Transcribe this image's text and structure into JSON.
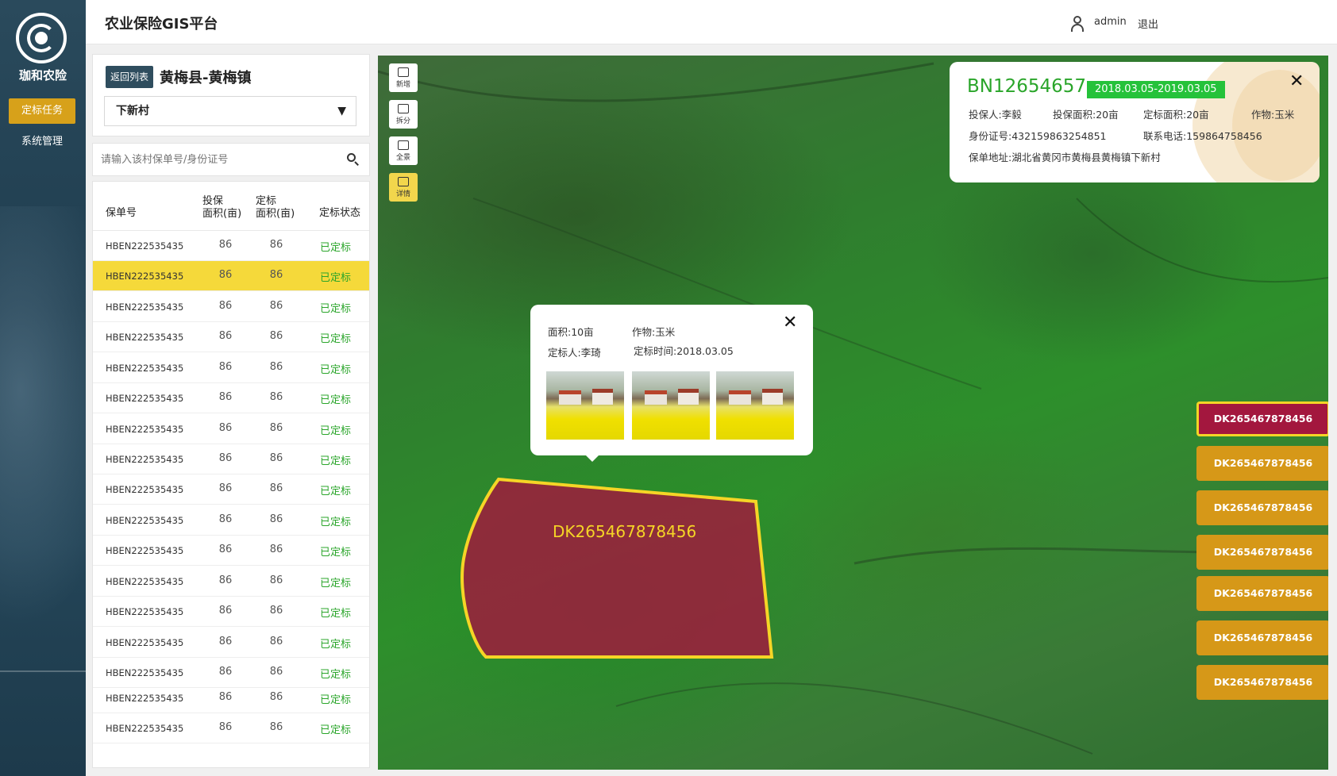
{
  "brand": {
    "name": "珈和农险"
  },
  "nav": {
    "items": [
      {
        "label": "定标任务"
      },
      {
        "label": "系统管理"
      }
    ]
  },
  "header": {
    "title": "农业保险GIS平台",
    "user": "admin",
    "logout": "退出"
  },
  "panel": {
    "back_label": "返回列表",
    "region": "黄梅县-黄梅镇",
    "village": "下新村",
    "search_placeholder": "请输入该村保单号/身份证号",
    "columns": [
      "保单号",
      "投保面积(亩)",
      "定标面积(亩)",
      "定标状态"
    ],
    "col_lines": {
      "insured_1": "投保",
      "insured_2": "面积(亩)",
      "marked_1": "定标",
      "marked_2": "面积(亩)"
    },
    "rows": [
      {
        "id": "HBEN222535435",
        "insured": "86",
        "marked": "86",
        "status": "已定标"
      },
      {
        "id": "HBEN222535435",
        "insured": "86",
        "marked": "86",
        "status": "已定标"
      },
      {
        "id": "HBEN222535435",
        "insured": "86",
        "marked": "86",
        "status": "已定标"
      },
      {
        "id": "HBEN222535435",
        "insured": "86",
        "marked": "86",
        "status": "已定标"
      },
      {
        "id": "HBEN222535435",
        "insured": "86",
        "marked": "86",
        "status": "已定标"
      },
      {
        "id": "HBEN222535435",
        "insured": "86",
        "marked": "86",
        "status": "已定标"
      },
      {
        "id": "HBEN222535435",
        "insured": "86",
        "marked": "86",
        "status": "已定标"
      },
      {
        "id": "HBEN222535435",
        "insured": "86",
        "marked": "86",
        "status": "已定标"
      },
      {
        "id": "HBEN222535435",
        "insured": "86",
        "marked": "86",
        "status": "已定标"
      },
      {
        "id": "HBEN222535435",
        "insured": "86",
        "marked": "86",
        "status": "已定标"
      },
      {
        "id": "HBEN222535435",
        "insured": "86",
        "marked": "86",
        "status": "已定标"
      },
      {
        "id": "HBEN222535435",
        "insured": "86",
        "marked": "86",
        "status": "已定标"
      },
      {
        "id": "HBEN222535435",
        "insured": "86",
        "marked": "86",
        "status": "已定标"
      },
      {
        "id": "HBEN222535435",
        "insured": "86",
        "marked": "86",
        "status": "已定标"
      },
      {
        "id": "HBEN222535435",
        "insured": "86",
        "marked": "86",
        "status": "已定标"
      },
      {
        "id": "HBEN222535435",
        "insured": "86",
        "marked": "86",
        "status": "已定标"
      },
      {
        "id": "HBEN222535435",
        "insured": "86",
        "marked": "86",
        "status": "已定标"
      }
    ],
    "selected_index": 1
  },
  "tools": [
    {
      "label": "新增"
    },
    {
      "label": "拆分"
    },
    {
      "label": "全景"
    },
    {
      "label": "详情"
    }
  ],
  "policy_card": {
    "policy_no": "BN12654657",
    "period": "2018.03.05-2019.03.05",
    "holder": "投保人:李毅",
    "insured_area": "投保面积:20亩",
    "marked_area": "定标面积:20亩",
    "crop": "作物:玉米",
    "id_no": "身份证号:432159863254851",
    "phone": "联系电话:159864758456",
    "address": "保单地址:湖北省黄冈市黄梅县黄梅镇下新村"
  },
  "plot_popup": {
    "area": "面积:10亩",
    "crop": "作物:玉米",
    "marker": "定标人:李琦",
    "time": "定标时间:2018.03.05"
  },
  "plot": {
    "label": "DK265467878456"
  },
  "parcels": [
    "DK265467878456",
    "DK265467878456",
    "DK265467878456",
    "DK265467878456",
    "DK265467878456",
    "DK265467878456",
    "DK265467878456"
  ],
  "colors": {
    "accent": "#d7a11a",
    "selected_row": "#f5d93a",
    "status_green": "#2aa52a",
    "plot_fill": "#a3173e",
    "plot_border": "#f5d526",
    "nav_bg": "#2a4a5c"
  },
  "icons": {
    "close": "close-icon",
    "search": "search-icon",
    "user": "user-icon",
    "dropdown": "chevron-down-icon"
  }
}
